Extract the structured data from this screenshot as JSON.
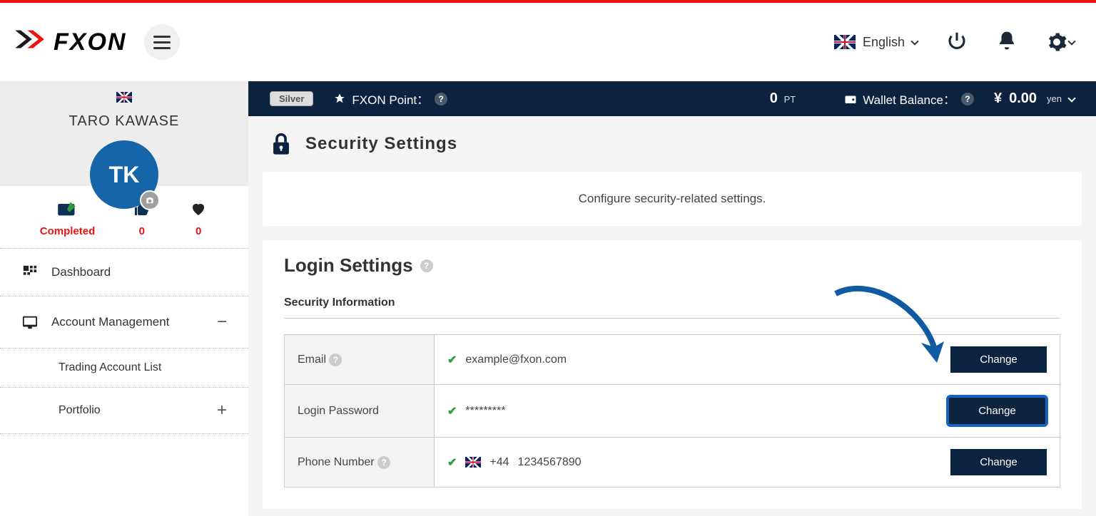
{
  "brand": "FXON",
  "header": {
    "lang_label": "English"
  },
  "sidebar": {
    "user_name": "TARO KAWASE",
    "avatar_initials": "TK",
    "stats": {
      "completed_label": "Completed",
      "likes": "0",
      "hearts": "0"
    },
    "nav": {
      "dashboard": "Dashboard",
      "account_mgmt": "Account Management",
      "trading_list": "Trading Account List",
      "portfolio": "Portfolio"
    }
  },
  "status": {
    "tier": "Silver",
    "point_label": "FXON Point：",
    "point_value": "0",
    "point_unit": "PT",
    "wallet_label": "Wallet Balance：",
    "wallet_symbol": "¥",
    "wallet_value": "0.00",
    "wallet_unit": "yen"
  },
  "page": {
    "title": "Security Settings",
    "description": "Configure security-related settings.",
    "login_heading": "Login Settings",
    "sec_info_heading": "Security Information",
    "rows": {
      "email_label": "Email",
      "email_value": "example@fxon.com",
      "pw_label": "Login Password",
      "pw_value": "*********",
      "phone_label": "Phone Number",
      "phone_cc": "+44",
      "phone_num": "1234567890",
      "change_btn": "Change"
    }
  }
}
